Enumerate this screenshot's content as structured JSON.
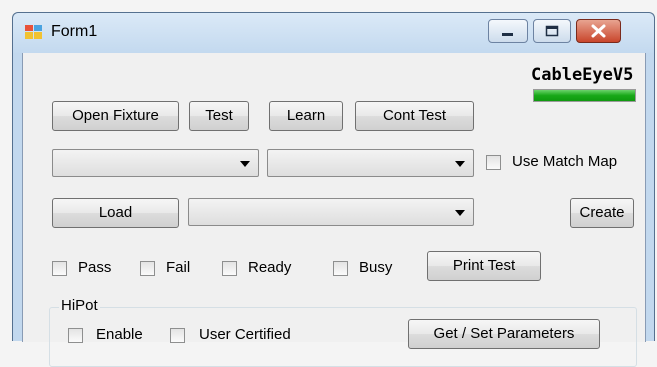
{
  "window": {
    "title": "Form1",
    "controls": {
      "minimize": "minimize-icon",
      "maximize": "maximize-icon",
      "close": "close-icon"
    },
    "icon": "form-app-icon"
  },
  "brand": {
    "label": "CableEyeV5",
    "progress": 1.0,
    "progress_color": "#18a818"
  },
  "toolbar": {
    "open_fixture": "Open Fixture",
    "test": "Test",
    "learn": "Learn",
    "cont_test": "Cont Test"
  },
  "row2": {
    "combo1_value": "",
    "combo2_value": "",
    "use_match_map": {
      "label": "Use Match Map",
      "checked": false
    }
  },
  "row3": {
    "load": "Load",
    "combo_value": "",
    "create": "Create"
  },
  "status": {
    "pass": {
      "label": "Pass",
      "checked": false
    },
    "fail": {
      "label": "Fail",
      "checked": false
    },
    "ready": {
      "label": "Ready",
      "checked": false
    },
    "busy": {
      "label": "Busy",
      "checked": false
    },
    "print_test": "Print Test"
  },
  "hipot": {
    "title": "HiPot",
    "enable": {
      "label": "Enable",
      "checked": false
    },
    "user_certified": {
      "label": "User Certified",
      "checked": false
    },
    "get_set_parameters": "Get / Set Parameters"
  }
}
